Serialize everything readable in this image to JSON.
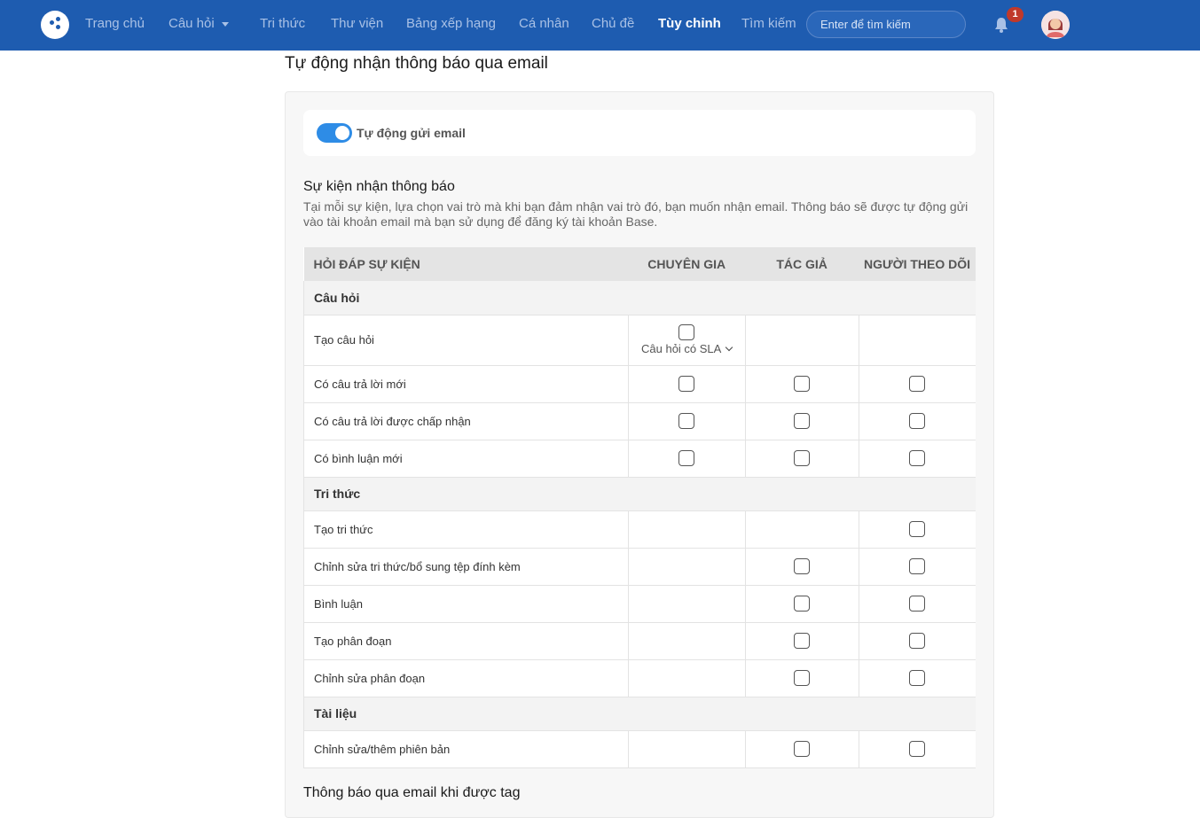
{
  "nav": {
    "items": [
      {
        "label": "Trang chủ"
      },
      {
        "label": "Câu hỏi"
      },
      {
        "label": "Tri thức"
      },
      {
        "label": "Thư viện"
      },
      {
        "label": "Bảng xếp hạng"
      },
      {
        "label": "Cá nhân"
      },
      {
        "label": "Chủ đề"
      },
      {
        "label": "Tùy chỉnh"
      },
      {
        "label": "Tìm kiếm"
      }
    ],
    "active": "Tùy chỉnh",
    "search_placeholder": "Enter để tìm kiếm",
    "notification_count": "1"
  },
  "colors": {
    "topbar": "#1e5cb0",
    "toggle_on": "#2e8ce6",
    "badge": "#c0392b"
  },
  "page": {
    "title": "Tự động nhận thông báo qua email",
    "toggle_label": "Tự động gửi email",
    "toggle_on": true,
    "events_title": "Sự kiện nhận thông báo",
    "events_desc": "Tại mỗi sự kiện, lựa chọn vai trò mà khi bạn đảm nhận vai trò đó, bạn muốn nhận email. Thông báo sẽ được tự động gửi vào tài khoản email mà bạn sử dụng để đăng ký tài khoản Base.",
    "tag_title": "Thông báo qua email khi được tag"
  },
  "table": {
    "headers": [
      "HỎI ĐÁP SỰ KIỆN",
      "CHUYÊN GIA",
      "TÁC GIẢ",
      "NGƯỜI THEO DÕI"
    ],
    "groups": [
      {
        "name": "Câu hỏi",
        "rows": [
          {
            "label": "Tạo câu hỏi",
            "sla_label": "Câu hỏi có SLA"
          },
          {
            "label": "Có câu trả lời mới"
          },
          {
            "label": "Có câu trả lời được chấp nhận"
          },
          {
            "label": "Có bình luận mới"
          }
        ]
      },
      {
        "name": "Tri thức",
        "rows": [
          {
            "label": "Tạo tri thức"
          },
          {
            "label": "Chỉnh sửa tri thức/bổ sung tệp đính kèm"
          },
          {
            "label": "Bình luận"
          },
          {
            "label": "Tạo phân đoạn"
          },
          {
            "label": "Chỉnh sửa phân đoạn"
          }
        ]
      },
      {
        "name": "Tài liệu",
        "rows": [
          {
            "label": "Chỉnh sửa/thêm phiên bản"
          }
        ]
      }
    ]
  }
}
